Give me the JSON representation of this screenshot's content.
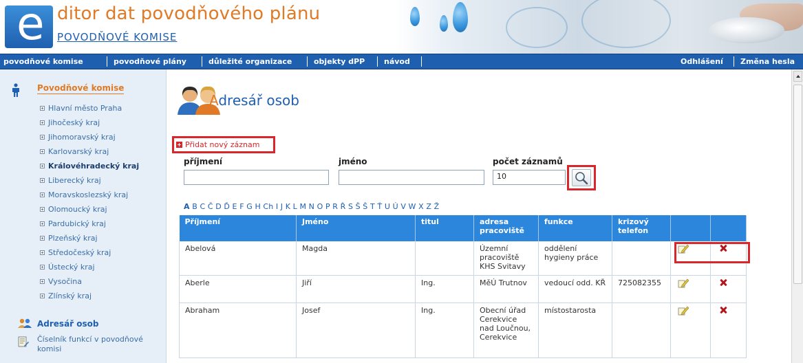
{
  "header": {
    "logo_letter": "e",
    "title": "ditor dat povodňového plánu",
    "subtitle": "POVODŇOVÉ KOMISE"
  },
  "nav": {
    "items": [
      "povodňové komise",
      "povodňové plány",
      "důležité organizace",
      "objekty dPP",
      "návod"
    ],
    "logout": "Odhlášení",
    "change_password": "Změna hesla"
  },
  "sidebar": {
    "title": "Povodňové komise",
    "items": [
      "Hlavní město Praha",
      "Jihočeský kraj",
      "Jihomoravský kraj",
      "Karlovarský kraj",
      "Královéhradecký kraj",
      "Liberecký kraj",
      "Moravskoslezský kraj",
      "Olomoucký kraj",
      "Pardubický kraj",
      "Plzeňský kraj",
      "Středočeský kraj",
      "Ústecký kraj",
      "Vysočina",
      "Zlínský kraj"
    ],
    "active_index": 4,
    "address_book": "Adresář osob",
    "functions_list": "Číselník funkcí v povodňové komisi"
  },
  "page": {
    "title_first": "A",
    "title_rest": "dresář osob",
    "add_link": "Přidat nový záznam"
  },
  "filters": {
    "surname_label": "příjmení",
    "surname_value": "",
    "name_label": "jméno",
    "name_value": "",
    "count_label": "počet záznamů",
    "count_value": "10"
  },
  "alphabet": {
    "first": "A",
    "rest": " B C Č D Ď E F G H Ch I J K L M N O P R Ř S Š Š T Ť U Ú V W X Z Ž"
  },
  "table": {
    "headers": [
      "Příjmení",
      "Jméno",
      "titul",
      "adresa pracoviště",
      "funkce",
      "krizový telefon",
      "",
      ""
    ],
    "rows": [
      {
        "surname": "Abelová",
        "name": "Magda",
        "title": "",
        "address": "Územní pracoviště KHS Svitavy",
        "function": "oddělení hygieny práce",
        "phone": ""
      },
      {
        "surname": "Aberle",
        "name": "Jiří",
        "title": "Ing.",
        "address": "MěÚ Trutnov",
        "function": "vedoucí odd. KŘ",
        "phone": "725082355"
      },
      {
        "surname": "Abraham",
        "name": "Josef",
        "title": "Ing.",
        "address": "Obecní úřad Cerekvice nad Loučnou, Cerekvice",
        "function": "místostarosta",
        "phone": ""
      }
    ]
  },
  "colors": {
    "accent_orange": "#e07a26",
    "brand_blue": "#1f5fb0",
    "table_header": "#2b86dc",
    "highlight_red": "#d8262a"
  }
}
